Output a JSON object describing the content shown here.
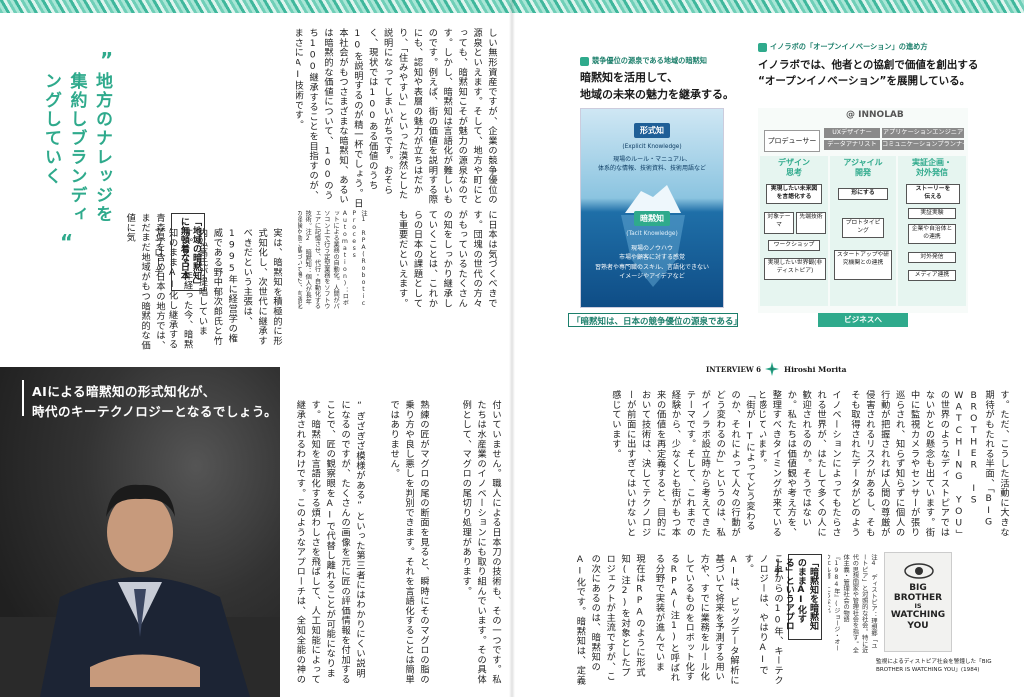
{
  "left_page": {
    "heading": [
      "地方のナレッジを集約し",
      "ブランディングしていく"
    ],
    "open_quote": "”",
    "close_quote": "“",
    "body_col1": "しい無形資産ですが、企業の競争優位の源泉といえます。そして、地方や町にとっても、暗黙知こそが魅力の源泉なのです。しかし、暗黙知は言語化が難しいものです。例えば、街の価値を説明する際にも、認知や表層の魅力が立ちはだかり、「住みやすい」といった漠然とした説明になってしまいがちです。おそらく、現状では100ある価値のうち10を説明するのが精一杯でしょう。日本社会がもつさまざまな暗黙知、あるいは暗黙的な価値について、100のうち100継承することを目指すのが、まさにAI技術です。",
    "body_col2": "実は、暗黙知を積極的に形式知化し、次世代に継承すべきだという主張は、1995年に経営学の権威である野中郁次郎氏と竹内弘高氏が提唱しています。25年経った今、暗黙知のままAI化し継承するアプローチ",
    "body_col3": "に日本は気づくべきです。団塊の世代の方々がもっているたくさんの知をしっかり継承していくことは、これからの日本の課題としても重要だといえます。",
    "note_col": "注1 RPA(Robotic Process Automation)：ロボットによる業務の自動化。人間がパソコン上で行う定型業務をソフトウェアに記憶させ、代行・自動化する技術。注2 暗黙知：個人が長年の経験や勘に基づいて得た、言語化できない知識。形式知：文章・図表・数式などによって説明・表現できる知識。注3 1995年に出版された『知識創造企業』",
    "box_heading": "「地域の暗黙知」に無頓着な日本",
    "box_body": "青森県を含め日本の地方では、まだまだ地域がもつ暗黙的な価値に気",
    "photo_quote": [
      "AIによる暗黙知の形式知化が、",
      "時代のキーテクノロジーとなるでしょう。"
    ],
    "body_col4": "付いていません。職人による日本刀の技術も、その一つです。私たちは水産業のイノベーションにも取り組んでいます。その具体例として、マグロの尾切り処理があります。",
    "body_col5": "熟練の匠がマグロの尾の断面を見ると、瞬時にそのマグロの脂の乗り方や良し悪しを判別できます。それを言語化することは簡単ではありません。",
    "body_col6": "“ぎざぎざ模様がある”といった第三者にはわかりにくい説明になるのですが、たくさんの画像を元に匠の評価情報を付加することで、匠の観察眼をAIで代替し離れることが可能になります。暗黙知を言語化する煩わしさを飛ばして、人工知能によって継承されるわけです。このようなアプローチは、全知全能の神の"
  },
  "right_page": {
    "left_label": "競争優位の源泉である地域の暗黙知",
    "left_title": [
      "暗黙知を活用して、",
      "地域の未来の魅力を継承する。"
    ],
    "iceberg": {
      "top_label": "形式知",
      "top_sub": "(Explicit Knowledge)",
      "top_body": [
        "現場のルール・マニュアル、",
        "体系的な情報、技術資料、技術用語など"
      ],
      "bottom_label": "暗黙知",
      "bottom_sub": "(Tacit Knowledge)",
      "bottom_body": [
        "現場のノウハウ",
        "市場や顧客に対する感覚",
        "習熟者や専門職のスキル、言語化できない",
        "イメージやアイデアなど"
      ]
    },
    "left_caption": "「暗黙知は、日本の競争優位の源泉である」",
    "right_label": "イノラボの「オープンイノベーション」の進め方",
    "right_title": [
      "イノラボでは、他者との協創で価値を創出する",
      "“オープンイノベーション”を展開している。"
    ],
    "chart": {
      "logo": "@ INNOLAB",
      "producer": "プロデューサー",
      "roles": [
        "UXデザイナー",
        "アプリケーションエンジニア",
        "データアナリスト",
        "コミュニケーションプランナー"
      ],
      "phases": [
        {
          "title": [
            "デザイン",
            "思考"
          ],
          "task": [
            "実現したい未来図",
            "を言語化する"
          ],
          "items": [
            "対象テーマ",
            "先端技術",
            "ワークショップ",
            "実現したい世界観(非ディストピア)"
          ]
        },
        {
          "title": [
            "アジャイル",
            "開発"
          ],
          "task": [
            "形にする"
          ],
          "items": [
            "プロトタイピング",
            "スタートアップや研究機関との連携"
          ]
        },
        {
          "title": [
            "実証企画・",
            "対外発信"
          ],
          "task": [
            "ストーリーを",
            "伝える"
          ],
          "items": [
            "実証実験",
            "企業や自治体との連携",
            "対外発信",
            "メディア連携"
          ]
        }
      ],
      "button": "ビジネスへ"
    },
    "interview_label": "INTERVIEW 6",
    "interviewee": "Hiroshi Morita",
    "body_col1": "す。ただ、こうした活動に大きな期待がもたれる半面、「BIG BROTHER IS WATCHING YOU」の世界のようなディストピアではないかとの懸念も出ています。街中に監視カメラやセンサーが張り巡らされ、知らず知らずに個人の行動が把握されれば人間の尊厳が侵害されるリスクがあるし、そもそも取得されたデータがどのように活用されるのかわからないのは不安だというわけです。",
    "body_col2": "イノベーションによってもたらされる世界が、はたして多くの人に歓迎されるのか。そうではないか。私たちは価値観や考え方を、整理すべきタイミングが来ていると感じています。",
    "body_col3": "「街がITによってどう変わるのか、それによって人々の行動がどう変わるのか」というのは、私がイノラボ設立時から考えてきたテーマです。そして、これまでの経験から、少なくとも街がもつ本来の価値を再定義すると、目的において技術は、決してテクノロジーが前面に出すぎてはいけないと感じています。",
    "box_heading": [
      "「暗黙知を暗黙知のまま",
      "AI化する」というアプローチ"
    ],
    "body_col4": "これからの10年、キーテクノロジーは、やはりAIです。",
    "body_col5": "AIは、ビッグデータ解析に基づいて将来を予測する用い方や、すでに業務をルール化しているものをロボット化するRPA(注1)と呼ばれる分野で実装が進んでいます。私たちも数多くのプロジェクトを進めています。",
    "body_col6": "現在はRPAのように形式知(注2)を対象としたプロジェクトが主流ですが、この次にあるのは、暗黙知のAI化です。暗黙知は、定義が難",
    "book_note": "注4 ディストピア：理想郷「ユートピア」と対照的な社会。特に近代の思想国家や管理社会を指す。全体主義・管理社会の物語『1984年』(ジョージ・オーウェル著)にちなむ。",
    "book_cover": [
      "BIG",
      "BROTHER",
      "IS",
      "WATCHING",
      "YOU"
    ],
    "book_caption": "監視によるディストピア社会を警鐘した「BIG BROTHER IS WATCHING YOU」(1984)"
  },
  "colors": {
    "accent": "#2faa8c",
    "accent_dark": "#1c7f6b",
    "ice_dark": "#0f4d86"
  }
}
